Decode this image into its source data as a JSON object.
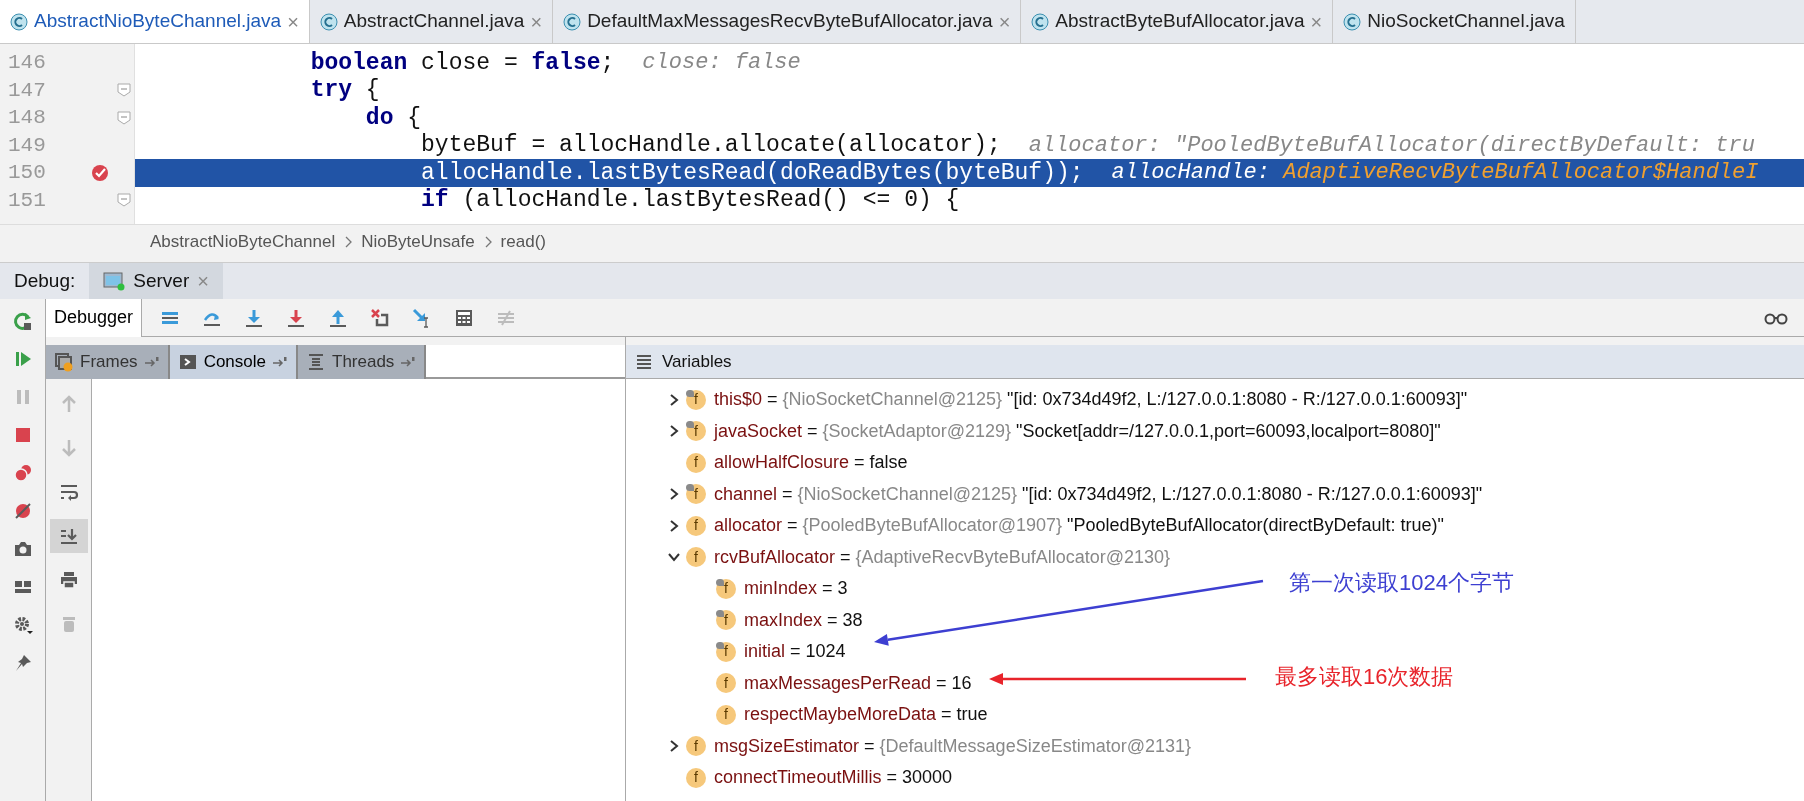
{
  "editor_tabs": [
    {
      "label": "AbstractNioByteChannel.java",
      "selected": true,
      "close": "×"
    },
    {
      "label": "AbstractChannel.java",
      "selected": false,
      "close": "×"
    },
    {
      "label": "DefaultMaxMessagesRecvByteBufAllocator.java",
      "selected": false,
      "close": "×"
    },
    {
      "label": "AbstractByteBufAllocator.java",
      "selected": false,
      "close": "×"
    },
    {
      "label": "NioSocketChannel.java",
      "selected": false
    }
  ],
  "code_lines": [
    {
      "number": "146",
      "code": "            **boolean** close = **false**;",
      "hint": "close: false",
      "fold": false,
      "breakpoint": false,
      "current": false
    },
    {
      "number": "147",
      "code": "            **try** {",
      "fold": true,
      "breakpoint": false,
      "current": false
    },
    {
      "number": "148",
      "code": "                **do** {",
      "fold": true,
      "breakpoint": false,
      "current": false
    },
    {
      "number": "149",
      "code": "                    byteBuf = allocHandle.allocate(allocator);",
      "hint": "allocator: \"PooledByteBufAllocator(directByDefault: tru",
      "fold": false,
      "breakpoint": false,
      "current": false
    },
    {
      "number": "150",
      "code": "                    allocHandle.lastBytesRead(doReadBytes(byteBuf));",
      "hint": "allocHandle:",
      "hint_value": "AdaptiveRecvByteBufAllocator$HandleI",
      "fold": false,
      "breakpoint": true,
      "current": true
    },
    {
      "number": "151",
      "code": "                    **if** (allocHandle.lastBytesRead() <= 0) {",
      "fold": true,
      "breakpoint": false,
      "current": false
    }
  ],
  "breadcrumbs": [
    "AbstractNioByteChannel",
    "NioByteUnsafe",
    "read()"
  ],
  "debug": {
    "label": "Debug:",
    "session": "Server",
    "session_close": "×"
  },
  "debugger_tab": {
    "label": "Debugger",
    "selected": true
  },
  "toolbar": [
    {
      "kind": "list",
      "disabled": false
    },
    {
      "kind": "step-over",
      "disabled": false
    },
    {
      "kind": "step-into",
      "disabled": false
    },
    {
      "kind": "force-step-into",
      "disabled": false
    },
    {
      "kind": "step-out",
      "disabled": false
    },
    {
      "kind": "drop-frame",
      "disabled": false
    },
    {
      "kind": "run-to-cursor",
      "disabled": false
    },
    {
      "kind": "calculator",
      "disabled": false
    },
    {
      "kind": "trace",
      "disabled": true
    }
  ],
  "left_rail": [
    {
      "kind": "rerun",
      "disabled": false
    },
    {
      "kind": "resume",
      "disabled": false
    },
    {
      "kind": "pause",
      "disabled": true
    },
    {
      "kind": "stop",
      "disabled": false
    },
    {
      "kind": "breakpoints",
      "disabled": false
    },
    {
      "kind": "mute",
      "disabled": false
    },
    {
      "kind": "camera",
      "disabled": false
    },
    {
      "kind": "layout",
      "disabled": false
    },
    {
      "kind": "gear",
      "disabled": false
    },
    {
      "kind": "pin",
      "disabled": false
    }
  ],
  "console_rail": [
    {
      "kind": "up",
      "disabled": true,
      "on": false
    },
    {
      "kind": "down",
      "disabled": true,
      "on": false
    },
    {
      "kind": "wrap",
      "disabled": false,
      "on": false
    },
    {
      "kind": "scroll-end",
      "disabled": false,
      "on": true
    },
    {
      "kind": "print",
      "disabled": false,
      "on": false
    },
    {
      "kind": "trash",
      "disabled": true,
      "on": false
    }
  ],
  "panel_tabs": [
    {
      "label": "Frames",
      "selected": false
    },
    {
      "label": "Console",
      "selected": true
    },
    {
      "label": "Threads",
      "selected": false
    }
  ],
  "variables": {
    "title": "Variables",
    "items": [
      {
        "icon": "f",
        "final": true,
        "name": "this$0",
        "operator": "=",
        "type": "{NioSocketChannel@2125}",
        "value": "\"[id: 0x734d49f2, L:/127.0.0.1:8080 - R:/127.0.0.1:60093]\"",
        "has_children": true,
        "expanded": false
      },
      {
        "icon": "f",
        "final": true,
        "name": "javaSocket",
        "operator": "=",
        "type": "{SocketAdaptor@2129}",
        "value": "\"Socket[addr=/127.0.0.1,port=60093,localport=8080]\"",
        "has_children": true,
        "expanded": false
      },
      {
        "icon": "f",
        "final": false,
        "name": "allowHalfClosure",
        "operator": "=",
        "value": "false",
        "has_children": false
      },
      {
        "icon": "f",
        "final": true,
        "name": "channel",
        "operator": "=",
        "type": "{NioSocketChannel@2125}",
        "value": "\"[id: 0x734d49f2, L:/127.0.0.1:8080 - R:/127.0.0.1:60093]\"",
        "has_children": true,
        "expanded": false
      },
      {
        "icon": "f",
        "final": false,
        "name": "allocator",
        "operator": "=",
        "type": "{PooledByteBufAllocator@1907}",
        "value": "\"PooledByteBufAllocator(directByDefault: true)\"",
        "has_children": true,
        "expanded": false
      },
      {
        "icon": "f",
        "final": false,
        "name": "rcvBufAllocator",
        "operator": "=",
        "type": "{AdaptiveRecvByteBufAllocator@2130}",
        "has_children": true,
        "expanded": true,
        "children": [
          {
            "icon": "f",
            "final": true,
            "name": "minIndex",
            "operator": "=",
            "value": "3",
            "has_children": false
          },
          {
            "icon": "f",
            "final": true,
            "name": "maxIndex",
            "operator": "=",
            "value": "38",
            "has_children": false
          },
          {
            "icon": "f",
            "final": true,
            "name": "initial",
            "operator": "=",
            "value": "1024",
            "has_children": false
          },
          {
            "icon": "f",
            "final": false,
            "name": "maxMessagesPerRead",
            "operator": "=",
            "value": "16",
            "has_children": false
          },
          {
            "icon": "f",
            "final": false,
            "name": "respectMaybeMoreData",
            "operator": "=",
            "value": "true",
            "has_children": false
          }
        ]
      },
      {
        "icon": "f",
        "final": false,
        "name": "msgSizeEstimator",
        "operator": "=",
        "type": "{DefaultMessageSizeEstimator@2131}",
        "has_children": true,
        "expanded": false
      },
      {
        "icon": "f",
        "final": false,
        "name": "connectTimeoutMillis",
        "operator": "=",
        "value": "30000",
        "has_children": false
      }
    ]
  },
  "annotations": [
    {
      "text": "第一次读取1024个字节",
      "color": "#3d3fd1"
    },
    {
      "text": "最多读取16次数据",
      "color": "#e8242b"
    }
  ]
}
